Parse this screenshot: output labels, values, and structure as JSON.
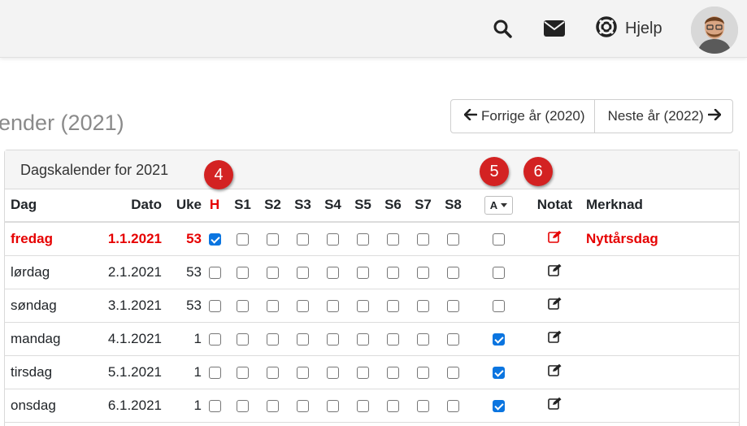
{
  "header": {
    "help_label": "Hjelp",
    "icons": [
      "search-icon",
      "mail-icon",
      "lifebuoy-icon"
    ]
  },
  "page": {
    "title": "lender (2021)",
    "prev_year_label": "Forrige år (2020)",
    "next_year_label": "Neste år (2022)"
  },
  "panel": {
    "title": "Dagskalender for 2021"
  },
  "badges": [
    "4",
    "5",
    "6"
  ],
  "table": {
    "columns": {
      "dag": "Dag",
      "dato": "Dato",
      "uke": "Uke",
      "h": "H",
      "s1": "S1",
      "s2": "S2",
      "s3": "S3",
      "s4": "S4",
      "s5": "S5",
      "s6": "S6",
      "s7": "S7",
      "s8": "S8",
      "a": "A",
      "notat": "Notat",
      "merknad": "Merknad"
    },
    "rows": [
      {
        "dag": "fredag",
        "dato": "1.1.2021",
        "uke": "53",
        "holiday": true,
        "h": true,
        "a": false,
        "merknad": "Nyttårsdag"
      },
      {
        "dag": "lørdag",
        "dato": "2.1.2021",
        "uke": "53",
        "holiday": false,
        "h": false,
        "a": false,
        "merknad": ""
      },
      {
        "dag": "søndag",
        "dato": "3.1.2021",
        "uke": "53",
        "holiday": false,
        "h": false,
        "a": false,
        "merknad": ""
      },
      {
        "dag": "mandag",
        "dato": "4.1.2021",
        "uke": "1",
        "holiday": false,
        "h": false,
        "a": true,
        "merknad": ""
      },
      {
        "dag": "tirsdag",
        "dato": "5.1.2021",
        "uke": "1",
        "holiday": false,
        "h": false,
        "a": true,
        "merknad": ""
      },
      {
        "dag": "onsdag",
        "dato": "6.1.2021",
        "uke": "1",
        "holiday": false,
        "h": false,
        "a": true,
        "merknad": ""
      }
    ]
  },
  "colors": {
    "holiday_red": "#e60000",
    "checkbox_blue": "#0b75e0",
    "badge_red": "#d32222"
  }
}
